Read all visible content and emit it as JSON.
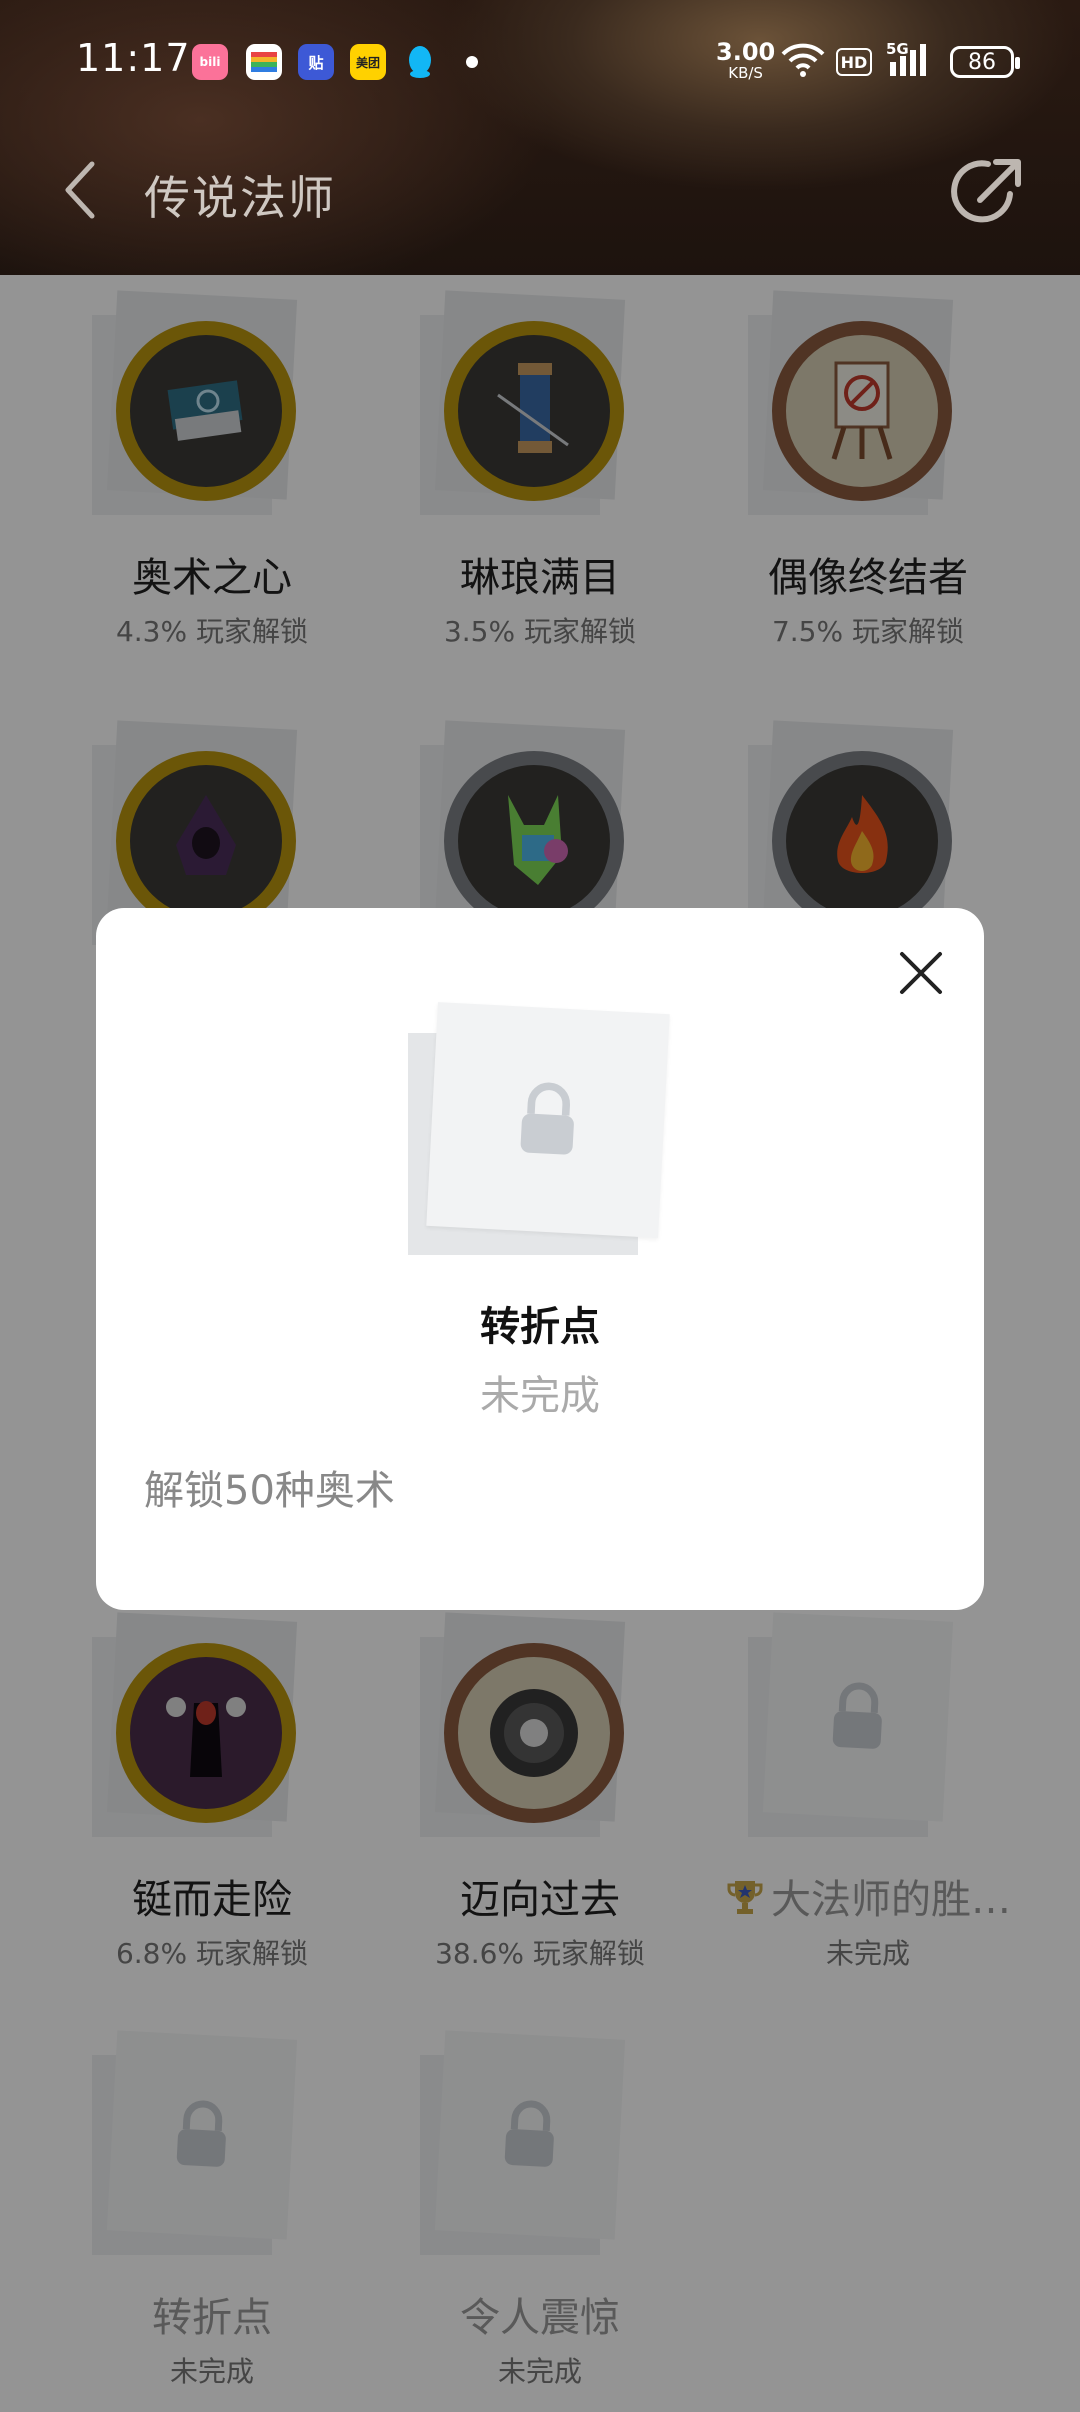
{
  "status_bar": {
    "time": "11:17",
    "app_icons": [
      {
        "name": "bilibili-icon",
        "label": "bili",
        "color": "#fb7299"
      },
      {
        "name": "wallet-icon",
        "label": "",
        "color": "#ffffff"
      },
      {
        "name": "tieba-icon",
        "label": "贴",
        "color": "#3d59d6"
      },
      {
        "name": "meituan-icon",
        "label": "美团",
        "color": "#ffd100"
      },
      {
        "name": "qq-icon",
        "label": "",
        "color": "#12b7f5"
      }
    ],
    "net_speed_value": "3.00",
    "net_speed_unit": "KB/S",
    "hd_label": "HD",
    "network_label": "5G",
    "battery": "86"
  },
  "header": {
    "title": "传说法师"
  },
  "achievements": [
    {
      "name": "奥术之心",
      "sub": "4.3% 玩家解锁",
      "locked": false,
      "ring": "#b8940f",
      "inner": "#3b3a36",
      "icon": "book-icon"
    },
    {
      "name": "琳琅满目",
      "sub": "3.5% 玩家解锁",
      "locked": false,
      "ring": "#b8940f",
      "inner": "#3b3a36",
      "icon": "spool-icon"
    },
    {
      "name": "偶像终结者",
      "sub": "7.5% 玩家解锁",
      "locked": false,
      "ring": "#8a5a3e",
      "inner": "#d8cfb5",
      "icon": "easel-icon"
    },
    {
      "name": "",
      "sub": "",
      "locked": false,
      "ring": "#b8940f",
      "inner": "#3b3a36",
      "icon": "hooded-figure-icon"
    },
    {
      "name": "",
      "sub": "",
      "locked": false,
      "ring": "#7d8086",
      "inner": "#3b3a36",
      "icon": "rainbow-beast-icon"
    },
    {
      "name": "",
      "sub": "",
      "locked": false,
      "ring": "#7d8086",
      "inner": "#3b3a36",
      "icon": "fire-icon"
    },
    {
      "name": "铤而走险",
      "sub": "6.8% 玩家解锁",
      "locked": false,
      "ring": "#b8940f",
      "inner": "#4a2e4a",
      "icon": "reaper-icon"
    },
    {
      "name": "迈向过去",
      "sub": "38.6% 玩家解锁",
      "locked": false,
      "ring": "#8a5a3e",
      "inner": "#d8cfb5",
      "icon": "portal-icon"
    },
    {
      "name": "大法师的胜…",
      "sub": "未完成",
      "locked": true,
      "trophy": true
    },
    {
      "name": "转折点",
      "sub": "未完成",
      "locked": true
    },
    {
      "name": "令人震惊",
      "sub": "未完成",
      "locked": true
    }
  ],
  "modal": {
    "title": "转折点",
    "status": "未完成",
    "description": "解锁50种奥术"
  }
}
